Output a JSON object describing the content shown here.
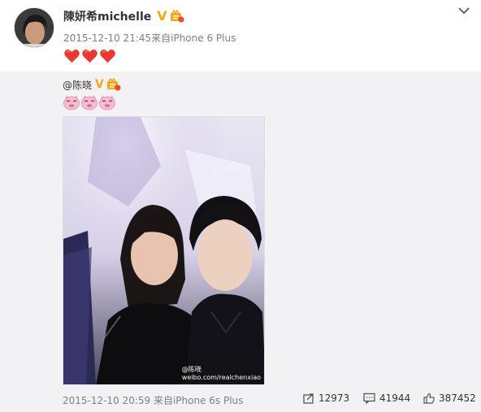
{
  "post": {
    "author": "陳妍希michelle",
    "timestamp": "2015-12-10 21:45来自iPhone 6 Plus",
    "emoji": [
      "heart",
      "heart",
      "heart"
    ]
  },
  "repost": {
    "mention": "@陈晓",
    "emoji": [
      "pig-face",
      "pig-face",
      "pig-face"
    ],
    "photo_watermark": "weibo.com/realchenxiao",
    "photo_watermark_handle": "@陈晓",
    "timestamp": "2015-12-10 20:59 来自iPhone 6s Plus",
    "stats": {
      "reposts": "12973",
      "comments": "41944",
      "likes": "387452"
    }
  },
  "colors": {
    "badge": "#f2a813",
    "heart": "#e8382f",
    "repost_bg": "#f2f2f5",
    "meta_text": "#808080"
  },
  "icons": {
    "header_menu": "chevron-down-icon",
    "repost": "repost-icon",
    "comment": "comment-icon",
    "like": "thumbs-up-icon"
  }
}
